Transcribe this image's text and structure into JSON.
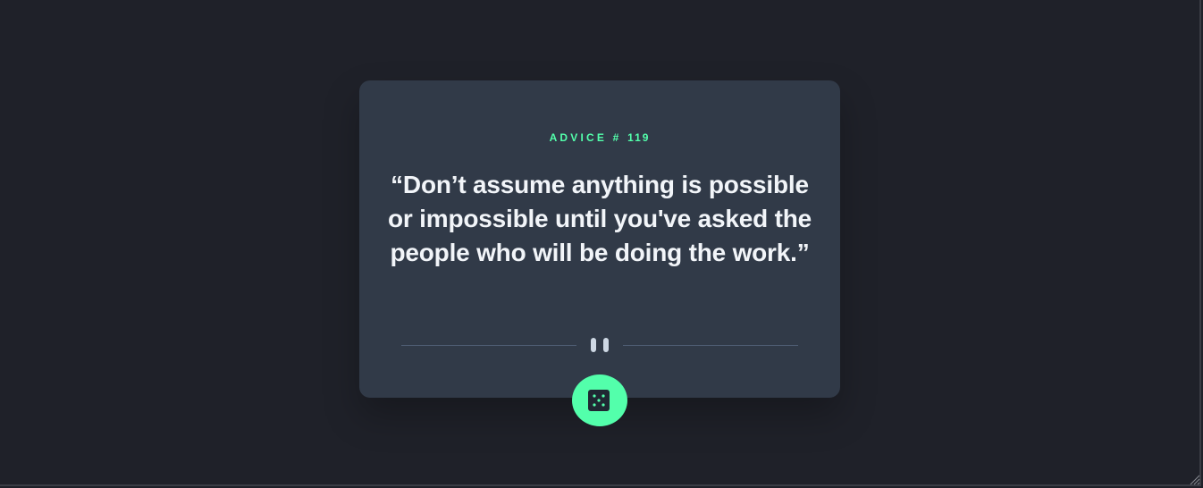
{
  "card": {
    "advice_label": "ADVICE #",
    "advice_number": "119",
    "quote": "“Don’t assume anything is possible or impossible until you've asked the people who will be doing the work.”"
  },
  "icons": {
    "divider": "pause-icon",
    "button": "dice-icon",
    "corner": "resize-grip-icon"
  },
  "colors": {
    "background": "#1f2129",
    "card": "#313a48",
    "accent": "#53ffab",
    "text": "#f2f5f9",
    "divider": "#4f5d74"
  }
}
